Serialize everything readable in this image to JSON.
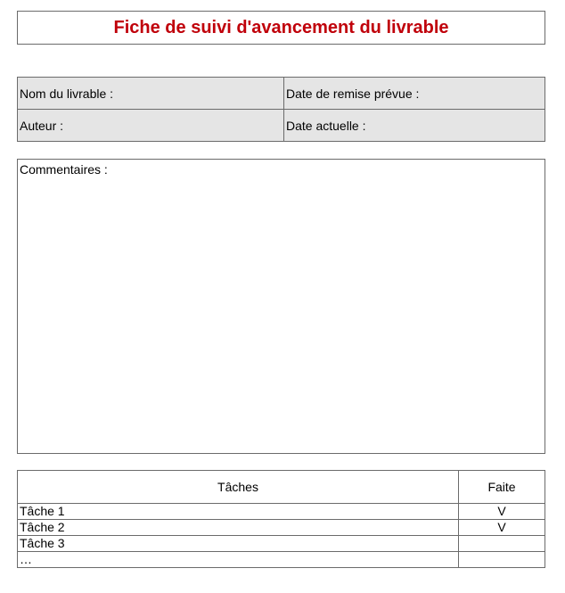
{
  "header": {
    "title": "Fiche de suivi d'avancement du livrable"
  },
  "info": {
    "deliverable_name_label": "Nom du livrable :",
    "due_date_label": "Date de remise prévue :",
    "author_label": "Auteur :",
    "current_date_label": "Date actuelle :"
  },
  "comments": {
    "label": "Commentaires :"
  },
  "tasks": {
    "header_task": "Tâches",
    "header_done": "Faite",
    "rows": [
      {
        "task": "Tâche 1",
        "done": "V"
      },
      {
        "task": "Tâche 2",
        "done": "V"
      },
      {
        "task": "Tâche 3",
        "done": ""
      },
      {
        "task": "…",
        "done": ""
      }
    ]
  },
  "colors": {
    "title": "#c0000a",
    "info_background": "#e5e5e5",
    "border": "#6b6b6b"
  }
}
